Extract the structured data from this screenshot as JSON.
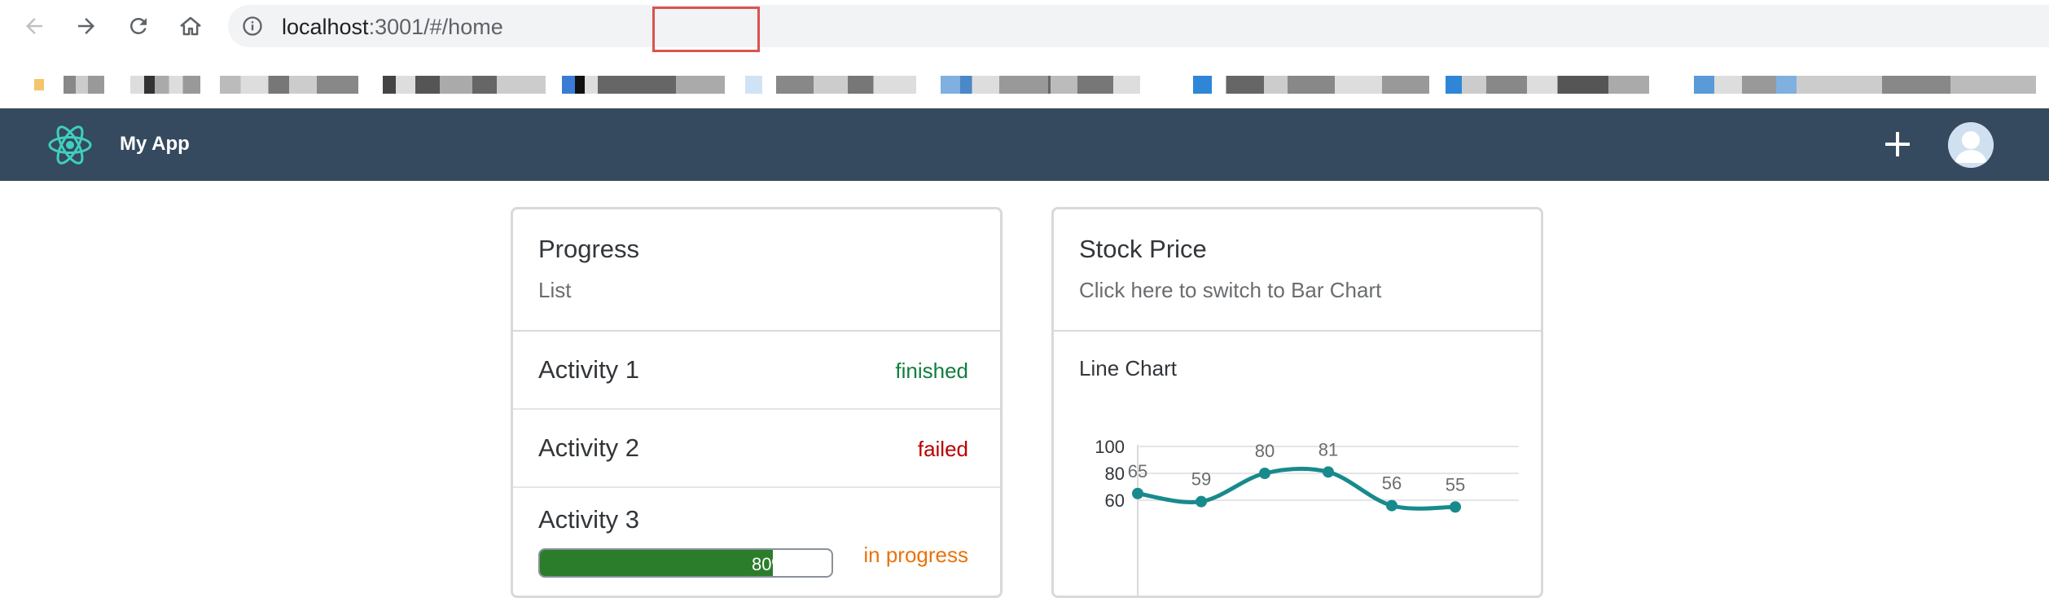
{
  "browser": {
    "url_host": "localhost",
    "url_port": ":3001",
    "url_hash": "/#/home"
  },
  "app": {
    "title": "My App",
    "logo_icon": "react-atom-icon",
    "accent": "#61dafb",
    "shellbar_color": "#354a5f"
  },
  "progress_card": {
    "title": "Progress",
    "subtitle": "List",
    "items": [
      {
        "title": "Activity 1",
        "status": "finished",
        "state": "success"
      },
      {
        "title": "Activity 2",
        "status": "failed",
        "state": "error"
      },
      {
        "title": "Activity 3",
        "status": "in progress",
        "state": "warning",
        "progress_text": "80%",
        "progress_value": 0.8
      }
    ]
  },
  "stock_card": {
    "title": "Stock Price",
    "subtitle": "Click here to switch to Bar Chart",
    "chart_title": "Line Chart"
  },
  "chart_data": {
    "type": "line",
    "title": "Line Chart",
    "y_ticks": [
      "100",
      "80",
      "60"
    ],
    "ylim": [
      0,
      100
    ],
    "grid": true,
    "color": "#188a8d",
    "points": [
      {
        "value": 65,
        "label": "65"
      },
      {
        "value": 59,
        "label": "59"
      },
      {
        "value": 80,
        "label": "80"
      },
      {
        "value": 81,
        "label": "81"
      },
      {
        "value": 56,
        "label": "56"
      },
      {
        "value": 55,
        "label": "55"
      }
    ]
  }
}
